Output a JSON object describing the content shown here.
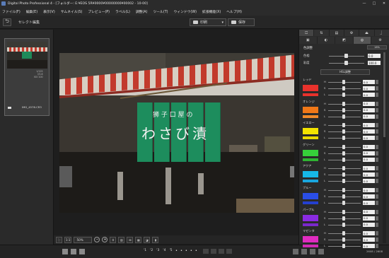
{
  "window": {
    "title": "Digital Photo Professional 4 - [フォルダー: E:¥EOS 5R¥0000¥00000000¥00002 - 10-00]",
    "minimize": "—",
    "maximize": "□",
    "close": "✕"
  },
  "menu": [
    "ファイル(F)",
    "編集(E)",
    "表示(V)",
    "サムネイル(S)",
    "プレビュー(P)",
    "ラベル(L)",
    "調整(A)",
    "ツール(T)",
    "ウィンドウ(W)",
    "拡張機能(X)",
    "ヘルプ(H)"
  ],
  "toolbar": {
    "back_icon": "⮌",
    "mode_label": "セレクト編集",
    "print_label": "印刷",
    "print_caret": "▾",
    "save_label": "保存"
  },
  "thumbnail": {
    "filename": "IMG_4576.CR3",
    "meta_lines": [
      "1/125",
      "f/2.8",
      "ISO 100"
    ],
    "count": "1 / 129"
  },
  "photo": {
    "noren_small": "狮 子 口 屋 の",
    "noren_big": "わさび漬"
  },
  "viewbar": {
    "zoom": "50%",
    "zoom_out": "−",
    "zoom_in": "+"
  },
  "ratings": [
    "'1",
    "'2",
    "'3",
    "'4",
    "'5"
  ],
  "stars": [
    "•",
    "•",
    "•",
    "•",
    "•"
  ],
  "page_info": "2608 / 2608",
  "right_panel": {
    "tabs": [
      "⏍",
      "⇅",
      "▤",
      "⚙",
      "⏏",
      "⏌"
    ],
    "tools": [
      "▣",
      "◐",
      "◩",
      "◎",
      "⚙"
    ],
    "header": "色調整",
    "reset": "16%",
    "rows": [
      {
        "label": "色相",
        "value": "0.0",
        "knob": 0.45
      },
      {
        "label": "彩度",
        "value": "100.0",
        "knob": 0.45
      }
    ],
    "hsl_button": "HSL調整",
    "colors": [
      {
        "name": "レッド",
        "swatch": "#e8322c",
        "swatch2": "#e8322c",
        "h": "0.0",
        "s": "0.0",
        "l": "0.0"
      },
      {
        "name": "オレンジ",
        "swatch": "#f07818",
        "swatch2": "#f08a2a",
        "h": "0.0",
        "s": "0.0",
        "l": "0.0"
      },
      {
        "name": "イエロー",
        "swatch": "#f2e300",
        "swatch2": "#e8d800",
        "h": "0.0",
        "s": "0.0",
        "l": "0.0"
      },
      {
        "name": "グリーン",
        "swatch": "#36d03a",
        "swatch2": "#2fb432",
        "h": "0.0",
        "s": "0.0",
        "l": "0.0"
      },
      {
        "name": "アクア",
        "swatch": "#16b8e8",
        "swatch2": "#1aa6de",
        "h": "0.0",
        "s": "0.0",
        "l": "0.0"
      },
      {
        "name": "ブルー",
        "swatch": "#2a4ee6",
        "swatch2": "#2440d0",
        "h": "0.0",
        "s": "0.0",
        "l": "0.0"
      },
      {
        "name": "パープル",
        "swatch": "#8a2be2",
        "swatch2": "#7a28cc",
        "h": "0.0",
        "s": "0.0",
        "l": "0.0"
      },
      {
        "name": "マゼンタ",
        "swatch": "#e02cc0",
        "swatch2": "#d02ab4",
        "h": "0.0",
        "s": "0.0",
        "l": "0.0"
      }
    ]
  }
}
